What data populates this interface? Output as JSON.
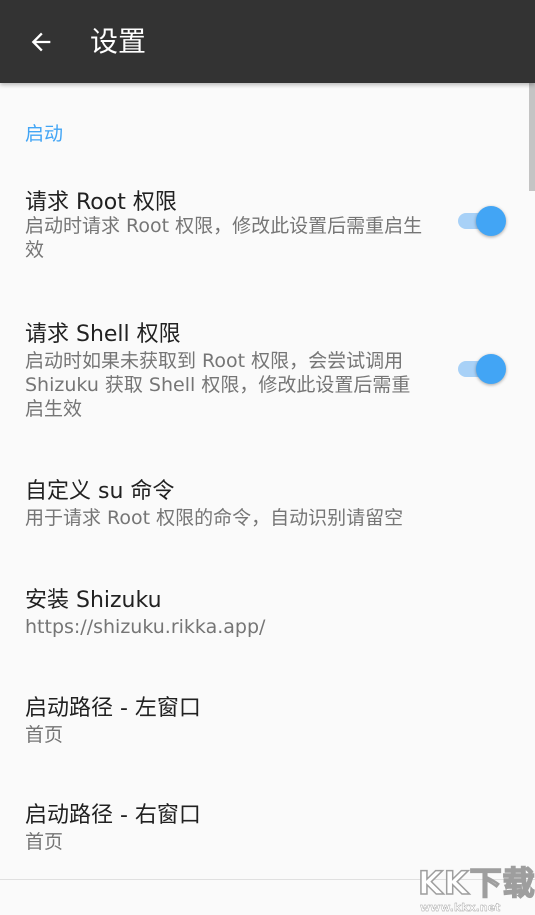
{
  "toolbar": {
    "title": "设置",
    "back_icon": "arrow-left-icon"
  },
  "section": {
    "category_label": "启动"
  },
  "preferences": [
    {
      "title": "请求 Root 权限",
      "summary": "启动时请求 Root 权限，修改此设置后需重启生效",
      "switch_on": true
    },
    {
      "title": "请求 Shell 权限",
      "summary": "启动时如果未获取到 Root 权限，会尝试调用 Shizuku 获取 Shell 权限，修改此设置后需重启生效",
      "switch_on": true
    },
    {
      "title": "自定义 su 命令",
      "summary": "用于请求 Root 权限的命令，自动识别请留空"
    },
    {
      "title": "安装 Shizuku",
      "summary": "https://shizuku.rikka.app/"
    },
    {
      "title": "启动路径 - 左窗口",
      "summary": "首页"
    },
    {
      "title": "启动路径 - 右窗口",
      "summary": "首页"
    }
  ],
  "watermark": {
    "logo_text": "KK下载",
    "url_text": "www.kkx.net"
  },
  "colors": {
    "toolbar_bg": "#333333",
    "accent": "#42a5f5",
    "background": "#fafafa",
    "title_text": "#212121",
    "summary_text": "#757575"
  }
}
